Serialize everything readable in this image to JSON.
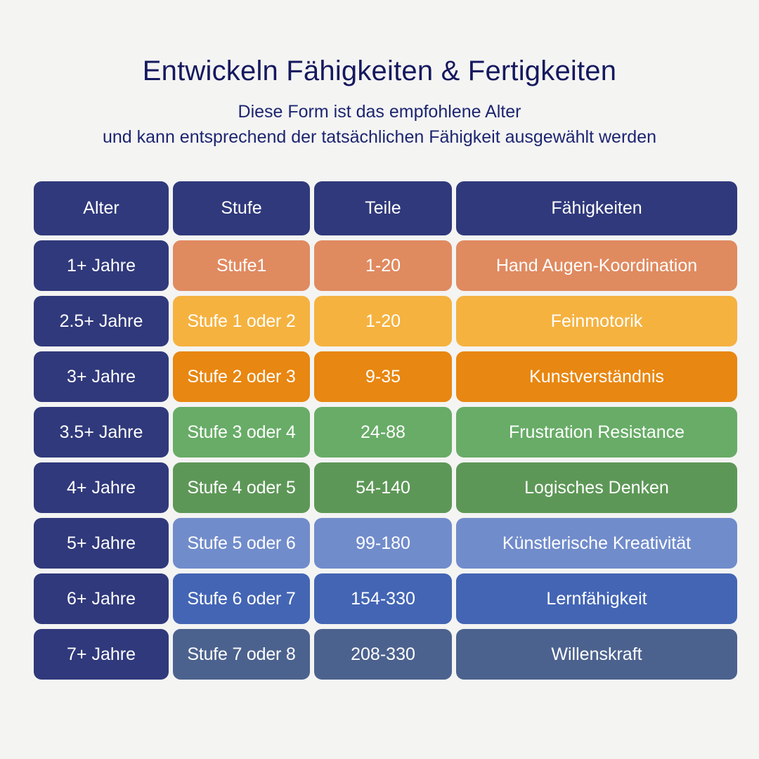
{
  "heading": {
    "title": "Entwickeln Fähigkeiten & Fertigkeiten",
    "subtitle_line1": "Diese Form ist das empfohlene Alter",
    "subtitle_line2": "und kann entsprechend der tatsächlichen Fähigkeit ausgewählt werden"
  },
  "colors": {
    "background": "#f4f4f3",
    "title_text": "#15195e",
    "subtitle_text": "#1d2570",
    "navy_header": "#30397b",
    "cell_text": "#ffffff"
  },
  "table": {
    "columns": [
      "Alter",
      "Stufe",
      "Teile",
      "Fähigkeiten"
    ],
    "rows": [
      {
        "age": "1+ Jahre",
        "stage": "Stufe1",
        "pieces": "1-20",
        "skill": "Hand Augen-Koordination",
        "color": "#e08a60"
      },
      {
        "age": "2.5+ Jahre",
        "stage": "Stufe 1 oder 2",
        "pieces": "1-20",
        "skill": "Feinmotorik",
        "color": "#f5b23f"
      },
      {
        "age": "3+ Jahre",
        "stage": "Stufe 2 oder 3",
        "pieces": "9-35",
        "skill": "Kunstverständnis",
        "color": "#e88711"
      },
      {
        "age": "3.5+ Jahre",
        "stage": "Stufe 3 oder 4",
        "pieces": "24-88",
        "skill": "Frustration Resistance",
        "color": "#68ac67"
      },
      {
        "age": "4+ Jahre",
        "stage": "Stufe 4 oder 5",
        "pieces": "54-140",
        "skill": "Logisches Denken",
        "color": "#5d9757"
      },
      {
        "age": "5+ Jahre",
        "stage": "Stufe 5 oder 6",
        "pieces": "99-180",
        "skill": "Künstlerische Kreativität",
        "color": "#718ccb"
      },
      {
        "age": "6+ Jahre",
        "stage": "Stufe 6 oder 7",
        "pieces": "154-330",
        "skill": "Lernfähigkeit",
        "color": "#4365b4"
      },
      {
        "age": "7+ Jahre",
        "stage": "Stufe 7 oder 8",
        "pieces": "208-330",
        "skill": "Willenskraft",
        "color": "#4c628e"
      }
    ]
  }
}
